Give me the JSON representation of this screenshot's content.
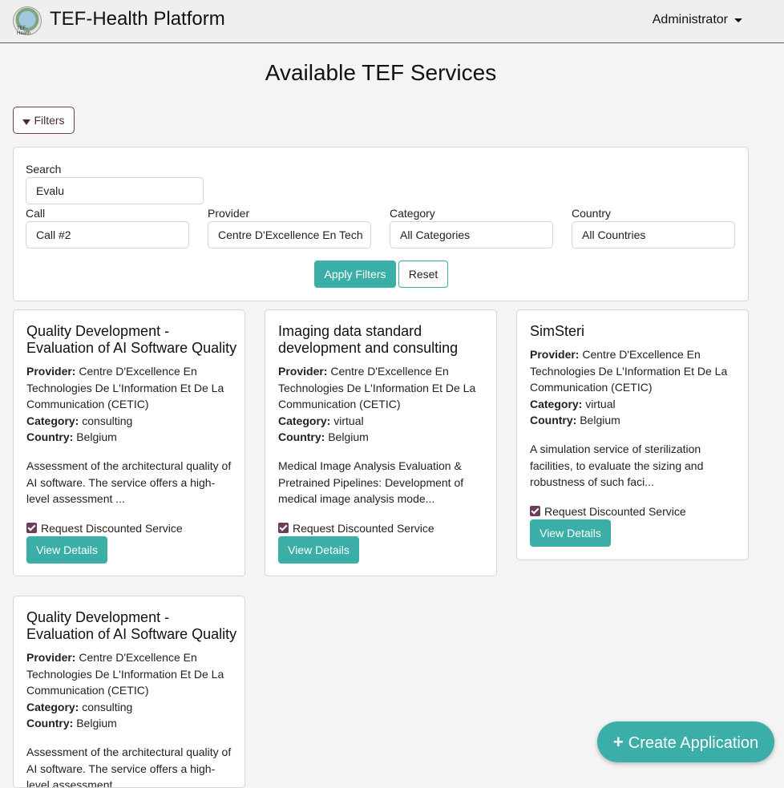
{
  "nav": {
    "brand": "TEF-Health Platform",
    "logo_text": "TEF-Health",
    "user_menu": "Administrator"
  },
  "page": {
    "title": "Available TEF Services"
  },
  "filters": {
    "toggle_label": "Filters",
    "search_label": "Search",
    "search_value": "Evalu",
    "call_label": "Call",
    "call_value": "Call #2",
    "provider_label": "Provider",
    "provider_value": "Centre D'Excellence En Tech",
    "category_label": "Category",
    "category_value": "All Categories",
    "country_label": "Country",
    "country_value": "All Countries",
    "apply_label": "Apply Filters",
    "reset_label": "Reset"
  },
  "labels": {
    "provider": "Provider:",
    "category": "Category:",
    "country": "Country:",
    "request_discount": "Request Discounted Service",
    "view_details": "View Details"
  },
  "cards": [
    {
      "title": "Quality Development - Evaluation of AI Software Quality",
      "provider": "Centre D'Excellence En Technologies De L'Information Et De La Communication (CETIC)",
      "category": "consulting",
      "country": "Belgium",
      "description": "Assessment of the architectural quality of AI software. The service offers a high-level assessment ...",
      "discount_checked": true
    },
    {
      "title": "Imaging data standard development and consulting",
      "provider": "Centre D'Excellence En Technologies De L'Information Et De La Communication (CETIC)",
      "category": "virtual",
      "country": "Belgium",
      "description": "Medical Image Analysis Evaluation & Pretrained Pipelines: Development of medical image analysis mode...",
      "discount_checked": true
    },
    {
      "title": "SimSteri",
      "provider": "Centre D'Excellence En Technologies De L'Information Et De La Communication (CETIC)",
      "category": "virtual",
      "country": "Belgium",
      "description": "A simulation service of sterilization facilities, to evaluate the sizing and robustness of such faci...",
      "discount_checked": true
    },
    {
      "title": "Quality Development - Evaluation of AI Software Quality",
      "provider": "Centre D'Excellence En Technologies De L'Information Et De La Communication (CETIC)",
      "category": "consulting",
      "country": "Belgium",
      "description": "Assessment of the architectural quality of AI software. The service offers a high-level assessment ...",
      "discount_checked": true
    }
  ],
  "fab": {
    "label": "Create Application"
  },
  "colors": {
    "accent": "#3aaea7",
    "secondary": "#6b3f5c"
  }
}
